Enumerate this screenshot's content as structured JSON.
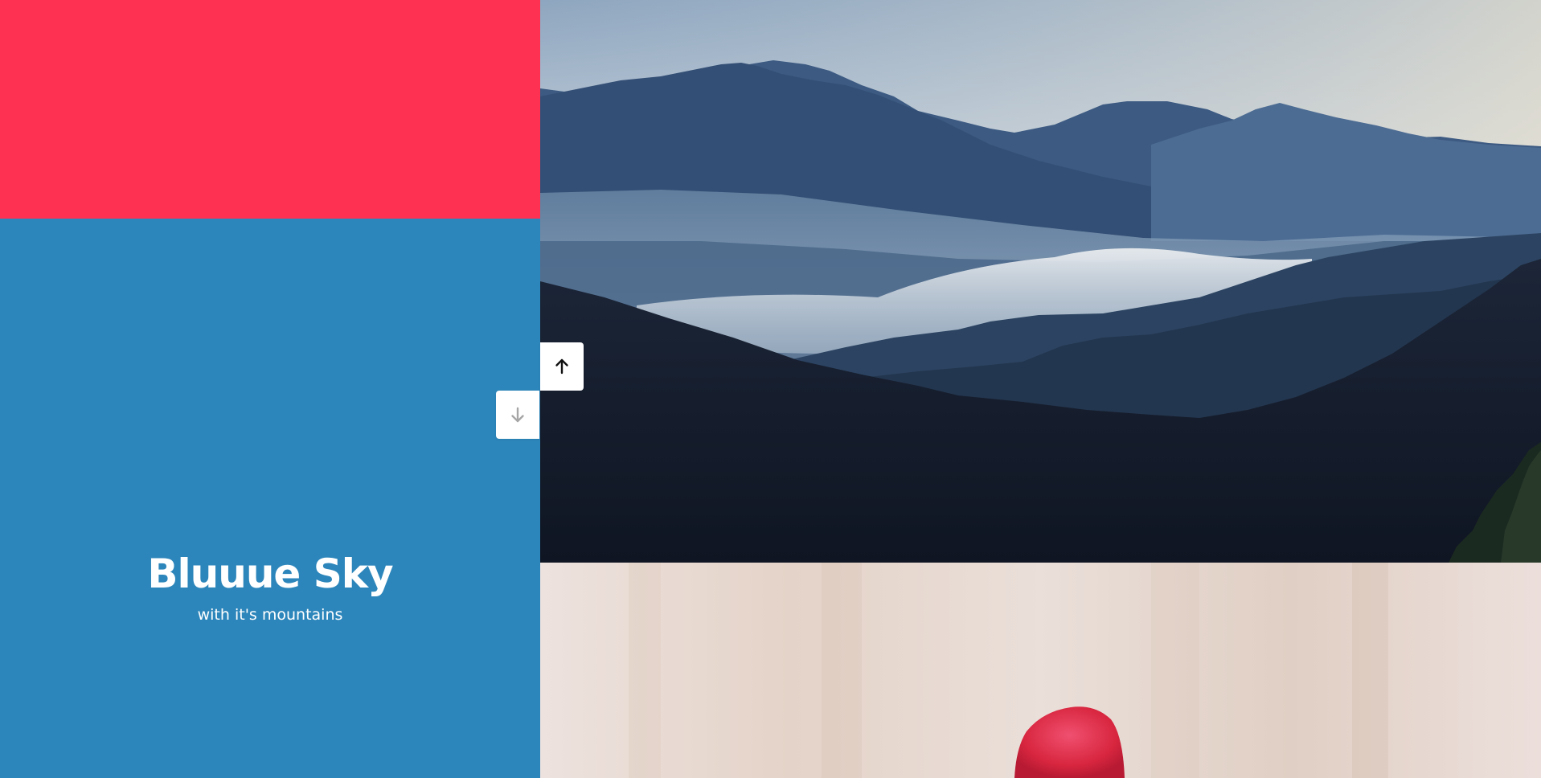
{
  "slides": {
    "left": [
      {
        "id": "red",
        "color": "#fe3152"
      },
      {
        "id": "blue",
        "color": "#2d86bb",
        "title": "Bluuue Sky",
        "subtitle": "with it's mountains"
      }
    ],
    "right": [
      {
        "id": "mountains",
        "image": "misty-mountain-ranges"
      },
      {
        "id": "flower",
        "image": "red-flower-on-light-background"
      }
    ]
  },
  "controls": {
    "up": {
      "icon": "arrow-up-icon",
      "state": "enabled"
    },
    "down": {
      "icon": "arrow-down-icon",
      "state": "disabled"
    }
  }
}
